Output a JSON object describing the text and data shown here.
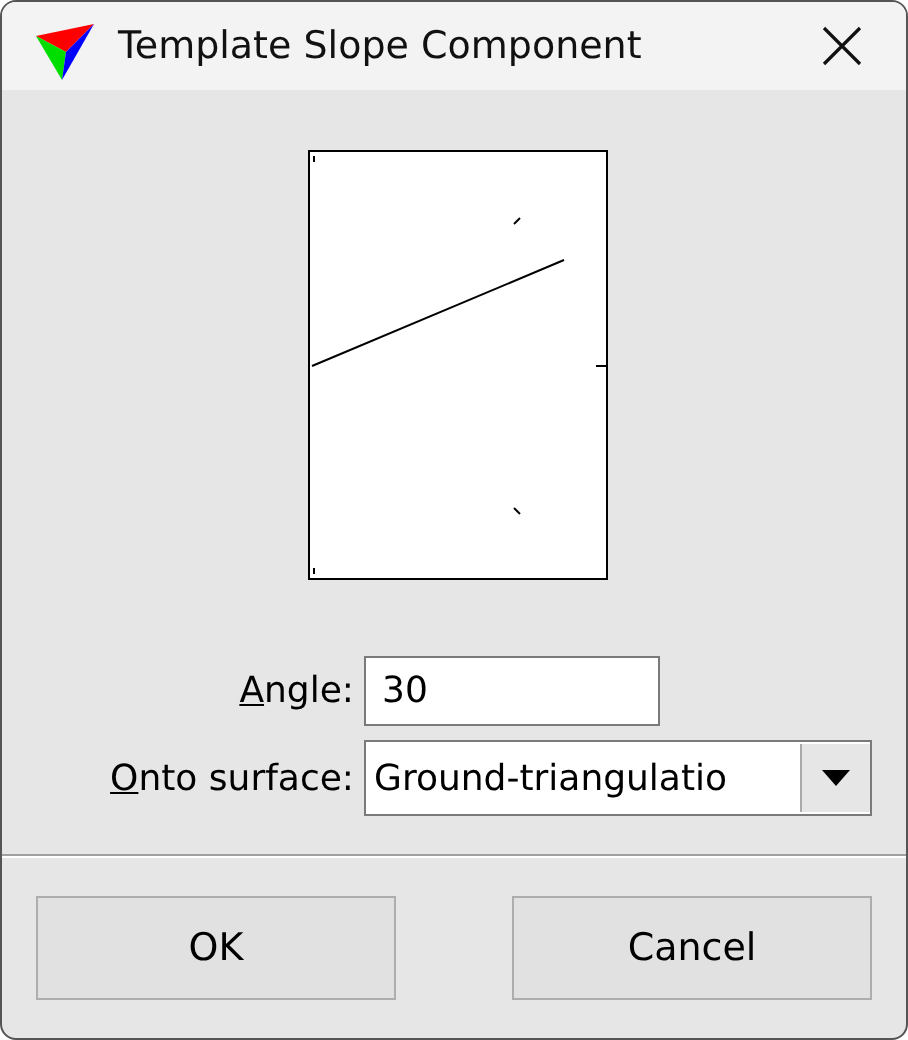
{
  "window": {
    "title": "Template Slope Component"
  },
  "fields": [
    {
      "kind": "text",
      "label": "Angle:",
      "mnemonic": true,
      "value": "30"
    },
    {
      "kind": "dropdown",
      "label": "Onto surface:",
      "mnemonic": true,
      "value": "Ground-triangulatio"
    }
  ],
  "buttons": [
    "OK",
    "Cancel"
  ]
}
